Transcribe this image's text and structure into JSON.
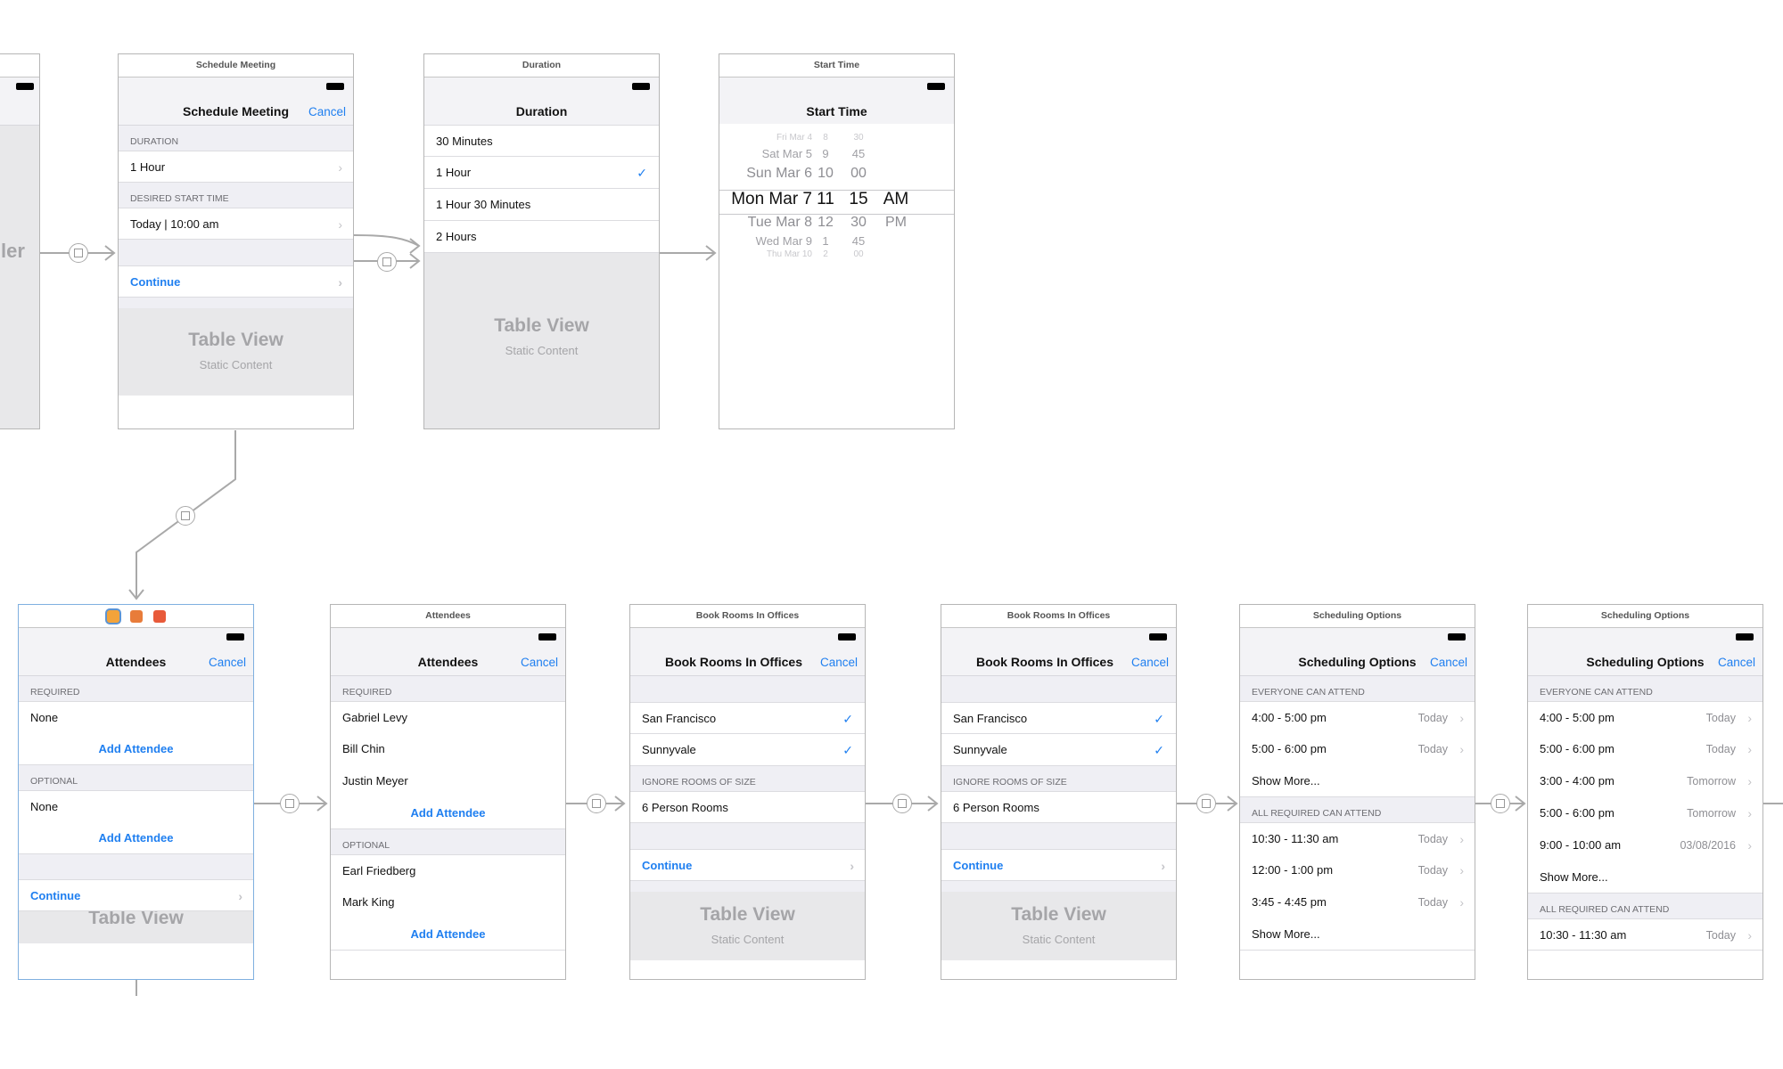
{
  "schedule_meeting": {
    "scene_title": "Schedule Meeting",
    "nav_title": "Schedule Meeting",
    "cancel": "Cancel",
    "duration_header": "DURATION",
    "duration_value": "1 Hour",
    "start_header": "DESIRED START TIME",
    "start_value": "Today | 10:00 am",
    "continue": "Continue",
    "table_view": "Table View",
    "static_content": "Static Content"
  },
  "duration": {
    "scene_title": "Duration",
    "nav_title": "Duration",
    "options": [
      "30 Minutes",
      "1 Hour",
      "1 Hour 30 Minutes",
      "2 Hours"
    ],
    "selected": "1 Hour",
    "table_view": "Table View",
    "static_content": "Static Content"
  },
  "start_time": {
    "scene_title": "Start Time",
    "nav_title": "Start Time",
    "picker_rows": [
      {
        "date": "Fri Mar 4",
        "hour": "8",
        "minute": "30",
        "ampm": ""
      },
      {
        "date": "Sat Mar 5",
        "hour": "9",
        "minute": "45",
        "ampm": ""
      },
      {
        "date": "Sun Mar 6",
        "hour": "10",
        "minute": "00",
        "ampm": ""
      },
      {
        "date": "Mon Mar 7",
        "hour": "11",
        "minute": "15",
        "ampm": "AM"
      },
      {
        "date": "Tue Mar 8",
        "hour": "12",
        "minute": "30",
        "ampm": "PM"
      },
      {
        "date": "Wed Mar 9",
        "hour": "1",
        "minute": "45",
        "ampm": ""
      },
      {
        "date": "Thu Mar 10",
        "hour": "2",
        "minute": "00",
        "ampm": ""
      }
    ]
  },
  "left_partial": {
    "label": "ler"
  },
  "attendees_1": {
    "nav_title": "Attendees",
    "cancel": "Cancel",
    "required_header": "REQUIRED",
    "required_value": "None",
    "add_attendee": "Add Attendee",
    "optional_header": "OPTIONAL",
    "optional_value": "None",
    "continue": "Continue",
    "table_view": "Table View"
  },
  "attendees_2": {
    "scene_title": "Attendees",
    "nav_title": "Attendees",
    "cancel": "Cancel",
    "required_header": "REQUIRED",
    "required": [
      "Gabriel Levy",
      "Bill Chin",
      "Justin Meyer"
    ],
    "add_attendee": "Add Attendee",
    "optional_header": "OPTIONAL",
    "optional": [
      "Earl Friedberg",
      "Mark King"
    ]
  },
  "book_rooms_1": {
    "scene_title": "Book Rooms In Offices",
    "nav_title": "Book Rooms In Offices",
    "cancel": "Cancel",
    "offices": [
      "San Francisco",
      "Sunnyvale"
    ],
    "ignore_header": "IGNORE ROOMS OF SIZE",
    "ignore_value": "6 Person Rooms",
    "continue": "Continue",
    "table_view": "Table View",
    "static_content": "Static Content"
  },
  "book_rooms_2": {
    "scene_title": "Book Rooms In Offices",
    "nav_title": "Book Rooms In Offices",
    "cancel": "Cancel",
    "offices": [
      "San Francisco",
      "Sunnyvale"
    ],
    "ignore_header": "IGNORE ROOMS OF SIZE",
    "ignore_value": "6 Person Rooms",
    "continue": "Continue",
    "table_view": "Table View",
    "static_content": "Static Content"
  },
  "scheduling_1": {
    "scene_title": "Scheduling Options",
    "nav_title": "Scheduling Options",
    "cancel": "Cancel",
    "everyone_header": "EVERYONE CAN ATTEND",
    "everyone": [
      {
        "time": "4:00 - 5:00 pm",
        "day": "Today"
      },
      {
        "time": "5:00 - 6:00 pm",
        "day": "Today"
      }
    ],
    "show_more": "Show More...",
    "required_header": "ALL REQUIRED CAN ATTEND",
    "required": [
      {
        "time": "10:30 - 11:30 am",
        "day": "Today"
      },
      {
        "time": "12:00 - 1:00 pm",
        "day": "Today"
      },
      {
        "time": "3:45 - 4:45 pm",
        "day": "Today"
      }
    ]
  },
  "scheduling_2": {
    "scene_title": "Scheduling Options",
    "nav_title": "Scheduling Options",
    "cancel": "Cancel",
    "everyone_header": "EVERYONE CAN ATTEND",
    "everyone": [
      {
        "time": "4:00 - 5:00 pm",
        "day": "Today"
      },
      {
        "time": "5:00 - 6:00 pm",
        "day": "Today"
      },
      {
        "time": "3:00 - 4:00 pm",
        "day": "Tomorrow"
      },
      {
        "time": "5:00 - 6:00 pm",
        "day": "Tomorrow"
      },
      {
        "time": "9:00 - 10:00 am",
        "day": "03/08/2016"
      }
    ],
    "show_more": "Show More...",
    "required_header": "ALL REQUIRED CAN ATTEND",
    "required": [
      {
        "time": "10:30 - 11:30 am",
        "day": "Today"
      }
    ]
  },
  "colors": {
    "tint": "#1f7ff0",
    "segue": "#a9a9a9"
  }
}
